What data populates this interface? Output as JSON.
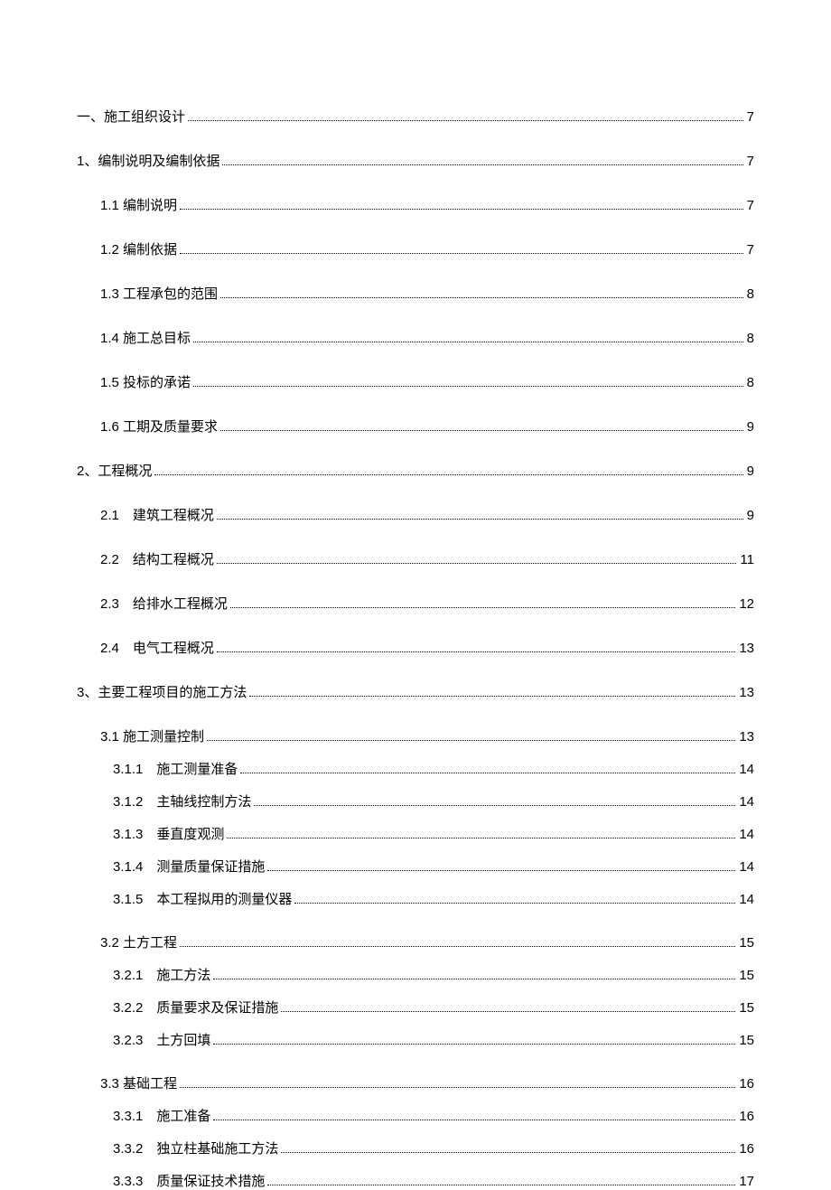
{
  "toc": [
    {
      "level": 0,
      "label": "一、施工组织设计",
      "page": "7"
    },
    {
      "level": 0,
      "label": "1、编制说明及编制依据",
      "page": "7"
    },
    {
      "level": 1,
      "label": "1.1 编制说明",
      "page": "7"
    },
    {
      "level": 1,
      "label": "1.2 编制依据",
      "page": "7"
    },
    {
      "level": 1,
      "label": "1.3 工程承包的范围",
      "page": "8"
    },
    {
      "level": 1,
      "label": "1.4 施工总目标",
      "page": "8"
    },
    {
      "level": 1,
      "label": "1.5 投标的承诺",
      "page": "8"
    },
    {
      "level": 1,
      "label": "1.6 工期及质量要求",
      "page": "9"
    },
    {
      "level": 0,
      "label": "2、工程概况",
      "page": "9"
    },
    {
      "level": 1,
      "label": "2.1　建筑工程概况",
      "page": "9"
    },
    {
      "level": 1,
      "label": "2.2　结构工程概况",
      "page": "11"
    },
    {
      "level": 1,
      "label": "2.3　给排水工程概况",
      "page": "12"
    },
    {
      "level": 1,
      "label": "2.4　电气工程概况",
      "page": "13"
    },
    {
      "level": 0,
      "label": "3、主要工程项目的施工方法",
      "page": "13"
    },
    {
      "level": 1,
      "label": "3.1 施工测量控制",
      "page": "13",
      "tight": true
    },
    {
      "level": 2,
      "label": "3.1.1　施工测量准备",
      "page": "14"
    },
    {
      "level": 2,
      "label": "3.1.2　主轴线控制方法",
      "page": "14"
    },
    {
      "level": 2,
      "label": "3.1.3　垂直度观测",
      "page": "14"
    },
    {
      "level": 2,
      "label": "3.1.4　测量质量保证措施",
      "page": "14"
    },
    {
      "level": 2,
      "label": "3.1.5　本工程拟用的测量仪器",
      "page": "14",
      "spacerAfter": true
    },
    {
      "level": 1,
      "label": "3.2 土方工程",
      "page": "15",
      "tight": true
    },
    {
      "level": 2,
      "label": "3.2.1　施工方法",
      "page": "15"
    },
    {
      "level": 2,
      "label": "3.2.2　质量要求及保证措施",
      "page": "15"
    },
    {
      "level": 2,
      "label": "3.2.3　土方回填",
      "page": "15",
      "spacerAfter": true
    },
    {
      "level": 1,
      "label": "3.3 基础工程",
      "page": "16",
      "tight": true
    },
    {
      "level": 2,
      "label": "3.3.1　施工准备",
      "page": "16"
    },
    {
      "level": 2,
      "label": "3.3.2　独立柱基础施工方法",
      "page": "16"
    },
    {
      "level": 2,
      "label": "3.3.3　质量保证技术措施",
      "page": "17"
    }
  ]
}
